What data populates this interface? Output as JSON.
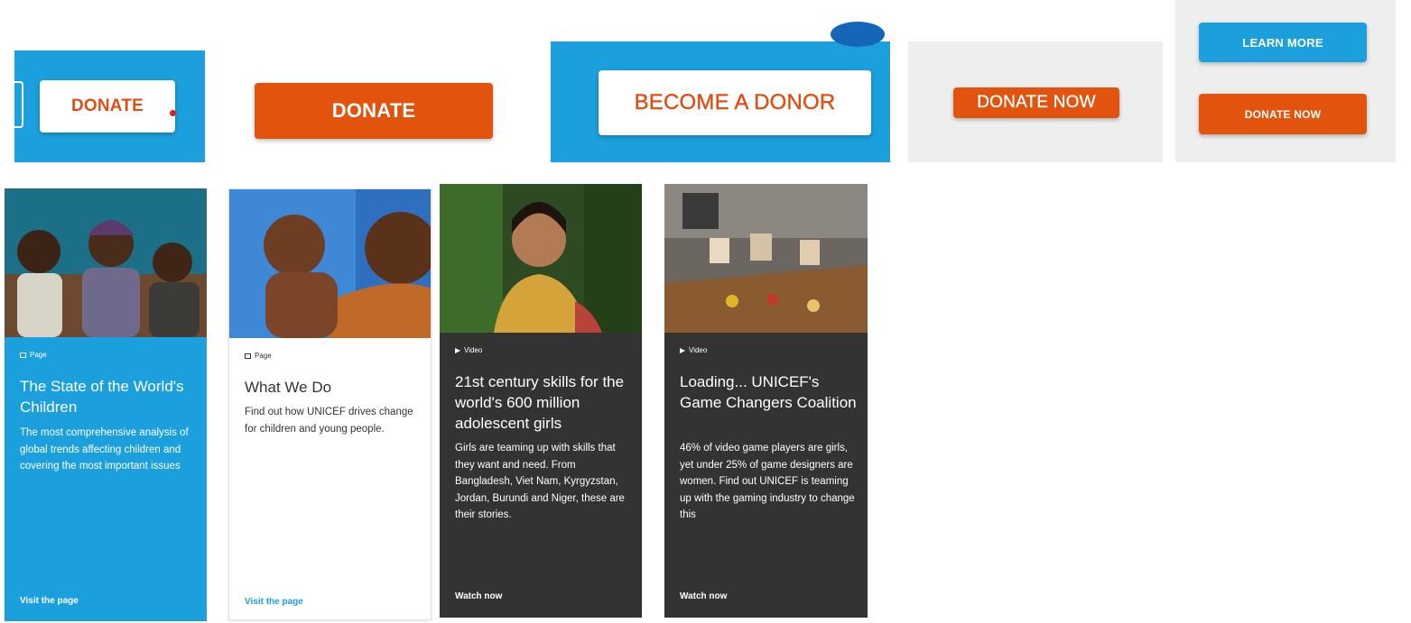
{
  "buttons": {
    "donate_white": "DONATE",
    "donate_orange": "DONATE",
    "become_donor": "BECOME A DONOR",
    "donate_now_gray": "DONATE NOW",
    "learn_more": "LEARN MORE",
    "donate_now_small": "DONATE NOW"
  },
  "cards": [
    {
      "meta": "Page",
      "title": "The State of the World's Children",
      "description": "The most comprehensive analysis of global trends affecting children and covering the most important issues",
      "link": "Visit the page"
    },
    {
      "meta": "Page",
      "title": "What We Do",
      "description": "Find out how UNICEF drives change for children and young people.",
      "link": "Visit the page"
    },
    {
      "meta": "Video",
      "title": "21st century skills for the world's 600 million adolescent girls",
      "description": "Girls are teaming up with skills that they want and need. From Bangladesh, Viet Nam, Kyrgyzstan, Jordan, Burundi and Niger, these are their stories.",
      "link": "Watch now"
    },
    {
      "meta": "Video",
      "title": "Loading... UNICEF's Game Changers Coalition",
      "description": "46% of video game players are girls, yet under 25% of game designers are women. Find out UNICEF is teaming up with the gaming industry to change this",
      "link": "Watch now"
    }
  ],
  "colors": {
    "unicef_blue": "#1CA0DD",
    "donate_orange": "#E2530D",
    "dark_card": "#333333",
    "light_panel": "#EEEEEE"
  },
  "icons": {
    "page": "page-icon",
    "video": "video-icon"
  }
}
